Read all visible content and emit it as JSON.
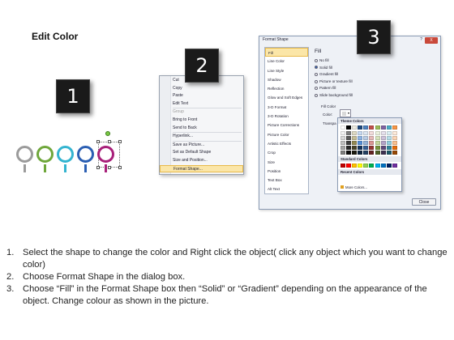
{
  "title": "Edit Color",
  "badges": [
    "1",
    "2",
    "3"
  ],
  "circles": [
    {
      "color": "#9b9b9b"
    },
    {
      "color": "#6fa73b"
    },
    {
      "color": "#34b4d0"
    },
    {
      "color": "#2b5fb3"
    },
    {
      "color": "#a8207a"
    }
  ],
  "context_menu": {
    "items": [
      {
        "label": "Cut",
        "icon": "scissors-icon",
        "color": "#6a88b8",
        "disabled": false,
        "submenu": false
      },
      {
        "label": "Copy",
        "icon": "copy-icon",
        "color": "#7a9cc8",
        "disabled": false,
        "submenu": false
      },
      {
        "label": "Paste",
        "icon": "paste-icon",
        "color": "#c8a040",
        "disabled": false,
        "submenu": false
      },
      {
        "label": "Edit Text",
        "icon": "edit-text-icon",
        "color": "#5a6f9a",
        "disabled": false,
        "submenu": false
      },
      {
        "label": "Group",
        "icon": "group-icon",
        "color": "#b0b0b0",
        "disabled": true,
        "submenu": true
      },
      {
        "label": "Bring to Front",
        "icon": "bring-front-icon",
        "color": "#5b8bd0",
        "disabled": false,
        "submenu": true
      },
      {
        "label": "Send to Back",
        "icon": "send-back-icon",
        "color": "#5b8bd0",
        "disabled": false,
        "submenu": true
      },
      {
        "label": "Hyperlink...",
        "icon": "hyperlink-icon",
        "color": "#3a6fc0",
        "disabled": false,
        "submenu": false
      },
      {
        "label": "Save as Picture...",
        "icon": "",
        "color": "",
        "disabled": false,
        "submenu": false
      },
      {
        "label": "Set as Default Shape",
        "icon": "",
        "color": "",
        "disabled": false,
        "submenu": false
      },
      {
        "label": "Size and Position...",
        "icon": "size-icon",
        "color": "#7a8aa0",
        "disabled": false,
        "submenu": false
      },
      {
        "label": "Format Shape...",
        "icon": "format-shape-icon",
        "color": "#e0a020",
        "disabled": false,
        "submenu": false
      }
    ]
  },
  "dialog": {
    "title": "Format Shape",
    "help": "?",
    "close_x": "X",
    "categories": [
      "Fill",
      "Line Color",
      "Line Style",
      "Shadow",
      "Reflection",
      "Glow and Soft Edges",
      "3-D Format",
      "3-D Rotation",
      "Picture Corrections",
      "Picture Color",
      "Artistic Effects",
      "Crop",
      "Size",
      "Position",
      "Text Box",
      "Alt Text"
    ],
    "active_category": "Fill",
    "fill_heading": "Fill",
    "fill_options": [
      {
        "label": "No fill",
        "selected": false
      },
      {
        "label": "Solid fill",
        "selected": true
      },
      {
        "label": "Gradient fill",
        "selected": false
      },
      {
        "label": "Picture or texture fill",
        "selected": false
      },
      {
        "label": "Pattern fill",
        "selected": false
      },
      {
        "label": "Slide background fill",
        "selected": false
      }
    ],
    "fill_color_label": "Fill Color",
    "color_label": "Color:",
    "transparency_label": "Transpa",
    "close_button": "Close"
  },
  "palette": {
    "theme_label": "Theme Colors",
    "standard_label": "Standard Colors",
    "recent_label": "Recent Colors",
    "more_label": "More Colors...",
    "theme_top": [
      "#ffffff",
      "#000000",
      "#eeece1",
      "#1f497d",
      "#4f81bd",
      "#c0504d",
      "#9bbb59",
      "#8064a2",
      "#4bacc6",
      "#f79646"
    ],
    "theme_shades": [
      [
        "#f2f2f2",
        "#7f7f7f",
        "#ddd9c3",
        "#c6d9f0",
        "#dbe5f1",
        "#f2dcdb",
        "#ebf1dd",
        "#e5e0ec",
        "#dbeef3",
        "#fdeada"
      ],
      [
        "#d8d8d8",
        "#595959",
        "#c4bd97",
        "#8db3e2",
        "#b8cce4",
        "#e5b9b7",
        "#d7e3bc",
        "#ccc1d9",
        "#b7dde8",
        "#fbd5b5"
      ],
      [
        "#bfbfbf",
        "#3f3f3f",
        "#938953",
        "#548dd4",
        "#95b3d7",
        "#d99694",
        "#c3d69b",
        "#b2a2c7",
        "#92cddc",
        "#fac08f"
      ],
      [
        "#a5a5a5",
        "#262626",
        "#494429",
        "#17365d",
        "#366092",
        "#953734",
        "#76923c",
        "#5f497a",
        "#31859b",
        "#e36c09"
      ],
      [
        "#7f7f7f",
        "#0c0c0c",
        "#1d1b10",
        "#0f243e",
        "#244061",
        "#632423",
        "#4f6128",
        "#3f3151",
        "#205867",
        "#974806"
      ]
    ],
    "standard": [
      "#c00000",
      "#ff0000",
      "#ffc000",
      "#ffff00",
      "#92d050",
      "#00b050",
      "#00b0f0",
      "#0070c0",
      "#002060",
      "#7030a0"
    ],
    "recent": [
      "#a8207a",
      "#2b5fb3",
      "#34b4d0",
      "#6fa73b",
      "#9b9b9b",
      "#e06c9f",
      "#f0a030",
      "#1f497d",
      "#c0504d",
      "#4bacc6"
    ]
  },
  "instructions": [
    {
      "num": "1.",
      "text": "Select the shape to change the color and Right click the object( click any object which you want to change color)"
    },
    {
      "num": "2.",
      "text": "Choose Format Shape in the dialog box."
    },
    {
      "num": "3.",
      "text": "Choose “Fill” in the Format Shape box then “Solid” or “Gradient” depending on the appearance of the object. Change colour as shown in the picture."
    }
  ]
}
